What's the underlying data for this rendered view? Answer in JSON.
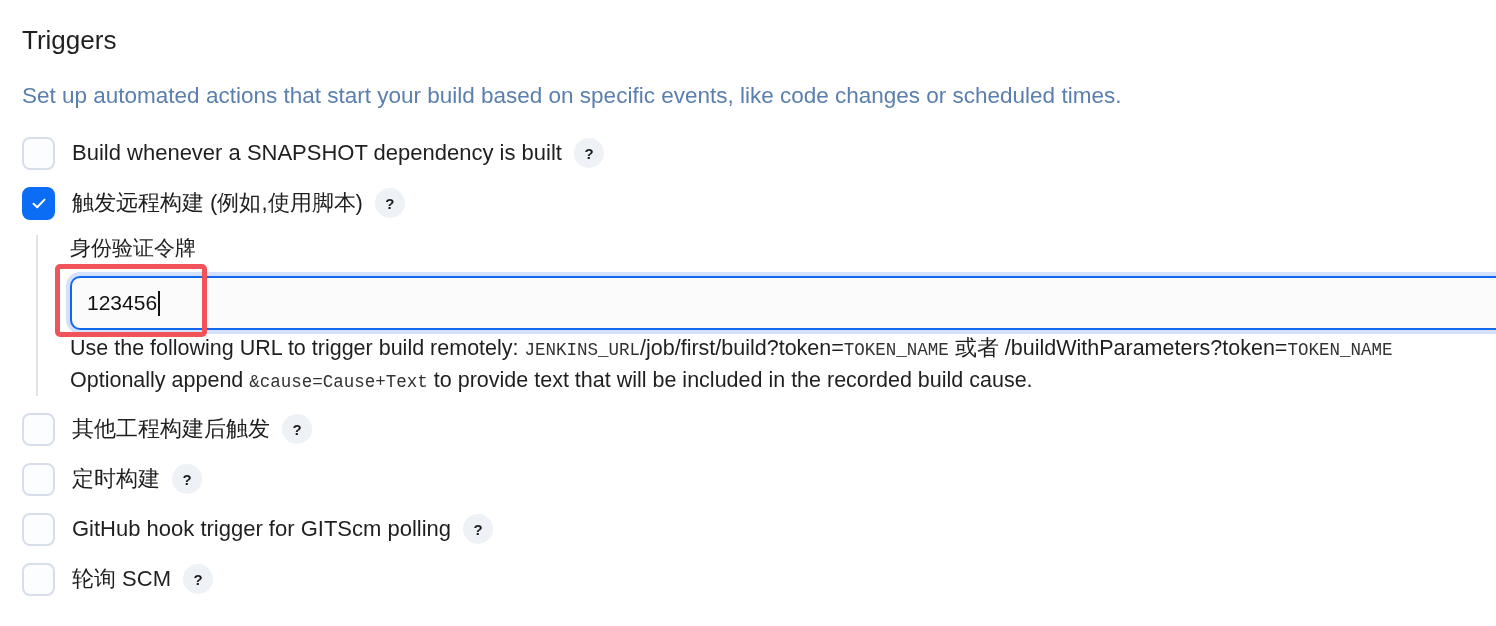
{
  "section": {
    "title": "Triggers",
    "description": "Set up automated actions that start your build based on specific events, like code changes or scheduled times."
  },
  "triggers": [
    {
      "label": "Build whenever a SNAPSHOT dependency is built",
      "checked": false,
      "help": "?"
    },
    {
      "label": "触发远程构建 (例如,使用脚本)",
      "checked": true,
      "help": "?",
      "options": {
        "token_field": {
          "label": "身份验证令牌",
          "value": "123456",
          "focused": true,
          "highlighted": true
        },
        "help_lines": [
          [
            {
              "kind": "text",
              "text": "Use the following URL to trigger build remotely: "
            },
            {
              "kind": "code",
              "text": "JENKINS_URL"
            },
            {
              "kind": "text",
              "text": "/job/first/build?token="
            },
            {
              "kind": "code",
              "text": "TOKEN_NAME"
            },
            {
              "kind": "text",
              "text": " 或者 /buildWithParameters?token="
            },
            {
              "kind": "code",
              "text": "TOKEN_NAME"
            }
          ],
          [
            {
              "kind": "text",
              "text": "Optionally append "
            },
            {
              "kind": "code",
              "text": "&cause=Cause+Text"
            },
            {
              "kind": "text",
              "text": " to provide text that will be included in the recorded build cause."
            }
          ]
        ]
      }
    },
    {
      "label": "其他工程构建后触发",
      "checked": false,
      "help": "?"
    },
    {
      "label": "定时构建",
      "checked": false,
      "help": "?"
    },
    {
      "label": "GitHub hook trigger for GITScm polling",
      "checked": false,
      "help": "?"
    },
    {
      "label": "轮询 SCM",
      "checked": false,
      "help": "?"
    }
  ]
}
